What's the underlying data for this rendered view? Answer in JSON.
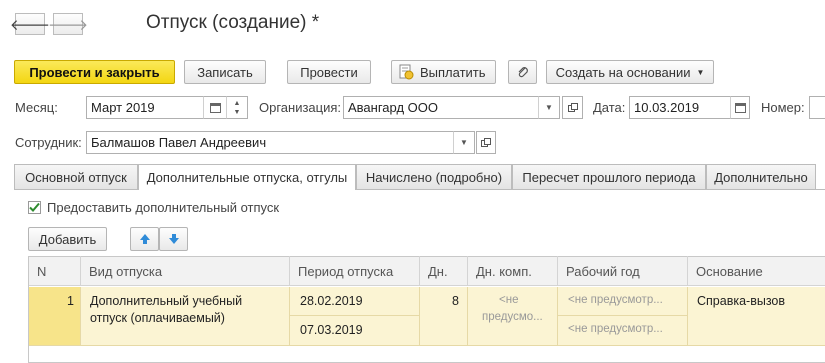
{
  "nav": {
    "back_glyph": "🡐",
    "forward_glyph": "🡒"
  },
  "header": {
    "title": "Отпуск (создание) *"
  },
  "toolbar": {
    "post_close": "Провести и закрыть",
    "save": "Записать",
    "post": "Провести",
    "pay": "Выплатить",
    "create_based": "Создать на основании"
  },
  "form": {
    "month_label": "Месяц:",
    "month_value": "Март 2019",
    "org_label": "Организация:",
    "org_value": "Авангард ООО",
    "date_label": "Дата:",
    "date_value": "10.03.2019",
    "number_label": "Номер:",
    "employee_label": "Сотрудник:",
    "employee_value": "Балмашов Павел Андреевич"
  },
  "tabs": [
    {
      "label": "Основной отпуск"
    },
    {
      "label": "Дополнительные отпуска, отгулы"
    },
    {
      "label": "Начислено (подробно)"
    },
    {
      "label": "Пересчет прошлого периода"
    },
    {
      "label": "Дополнительно"
    }
  ],
  "panel": {
    "checkbox_label": "Предоставить дополнительный отпуск",
    "add_button": "Добавить"
  },
  "table": {
    "columns": [
      "N",
      "Вид отпуска",
      "Период отпуска",
      "Дн.",
      "Дн. комп.",
      "Рабочий год",
      "Основание"
    ],
    "rows": [
      {
        "n": "1",
        "type_line1": "Дополнительный учебный",
        "type_line2": "отпуск (оплачиваемый)",
        "period_from": "28.02.2019",
        "period_to": "07.03.2019",
        "days": "8",
        "comp_line1": "<не",
        "comp_line2": "предусмо...",
        "work_year_1": "<не предусмотр...",
        "work_year_2": "<не предусмотр...",
        "basis": "Справка-вызов"
      }
    ]
  },
  "colors": {
    "accent": "#f3d612",
    "row_highlight": "#fbf4d3",
    "cell_focus": "#f7e48a"
  }
}
